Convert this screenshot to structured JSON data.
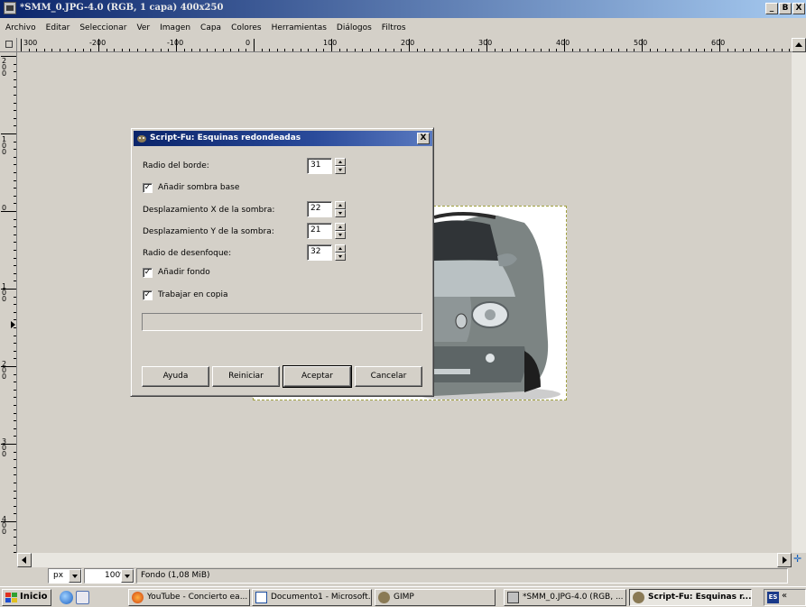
{
  "window": {
    "title": "*SMM_0.JPG-4.0 (RGB, 1 capa) 400x250",
    "controls": [
      "_",
      "B",
      "X"
    ]
  },
  "menu": [
    "Archivo",
    "Editar",
    "Seleccionar",
    "Ver",
    "Imagen",
    "Capa",
    "Colores",
    "Herramientas",
    "Diálogos",
    "Filtros"
  ],
  "hruler_labels": [
    "300",
    "-200",
    "-100",
    "0",
    "100",
    "200",
    "300",
    "400",
    "500",
    "600"
  ],
  "vruler_labels": [
    "200",
    "100",
    "0",
    "100",
    "200",
    "300",
    "400"
  ],
  "dialog": {
    "title": "Script-Fu: Esquinas redondeadas",
    "close": "X",
    "radio_borde_label": "Radio del borde:",
    "radio_borde_value": "31",
    "sombra_base_label": "Añadir sombra base",
    "sombra_base_checked": "✓",
    "despl_x_label": "Desplazamiento X de la sombra:",
    "despl_x_value": "22",
    "despl_y_label": "Desplazamiento Y de la sombra:",
    "despl_y_value": "21",
    "desenfoque_label": "Radio de desenfoque:",
    "desenfoque_value": "32",
    "fondo_label": "Añadir fondo",
    "fondo_checked": "✓",
    "copia_label": "Trabajar en copia",
    "copia_checked": "✓",
    "buttons": {
      "ayuda": "Ayuda",
      "reiniciar": "Reiniciar",
      "aceptar": "Aceptar",
      "cancelar": "Cancelar"
    }
  },
  "status": {
    "unit": "px",
    "zoom": "100%",
    "text": "Fondo (1,08 MiB)"
  },
  "taskbar": {
    "start": "Inicio",
    "tasks": [
      "YouTube - Concierto ea...",
      "Documento1 - Microsoft...",
      "GIMP",
      "*SMM_0.JPG-4.0 (RGB, ...",
      "Script-Fu: Esquinas r..."
    ],
    "lang": "ES",
    "tray_more": "«"
  },
  "colors": {
    "title_active": "#0a246a",
    "chrome": "#d4d0c8",
    "car_body": "#7c8483"
  }
}
